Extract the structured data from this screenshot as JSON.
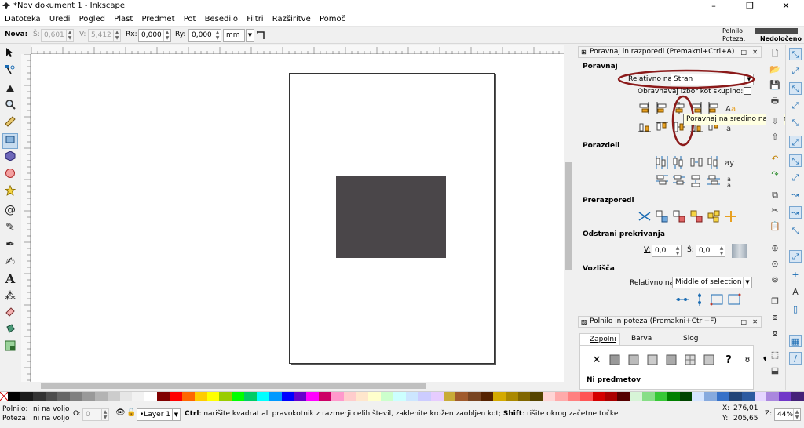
{
  "window": {
    "title": "*Nov dokument 1 - Inkscape",
    "min_glyph": "–",
    "max_glyph": "❐",
    "close_glyph": "✕"
  },
  "menu": [
    "Datoteka",
    "Uredi",
    "Pogled",
    "Plast",
    "Predmet",
    "Pot",
    "Besedilo",
    "Filtri",
    "Razširitve",
    "Pomoč"
  ],
  "tool_controls": {
    "label": "Nova:",
    "w_label": "Š:",
    "w_value": "0,601",
    "h_label": "V:",
    "h_value": "5,412",
    "rx_label": "Rx:",
    "rx_value": "0,000",
    "ry_label": "Ry:",
    "ry_value": "0,000",
    "unit": "mm"
  },
  "fill_indicator": {
    "fill_label": "Polnilo:",
    "stroke_label": "Poteza:",
    "stroke_value": "Nedoločeno",
    "fill_color": "#4a4a4a"
  },
  "tools": [
    "selector-icon",
    "node-icon",
    "tweak-icon",
    "zoom-icon",
    "measure-icon",
    "rect-icon",
    "3dbox-icon",
    "ellipse-icon",
    "star-icon",
    "spiral-icon",
    "pencil-icon",
    "pen-icon",
    "calligraphy-icon",
    "text-icon",
    "spray-icon",
    "eraser-icon",
    "bucket-icon",
    "gradient-icon"
  ],
  "canvas": {
    "rect_color": "#4a4649",
    "page_color": "#ffffff"
  },
  "align_dialog": {
    "title": "Poravnaj in razporedi  (Premakni+Ctrl+A)",
    "align_section": "Poravnaj",
    "relative_label": "Relativno na:",
    "relative_value": "Stran",
    "treat_group_label": "Obravnavaj izbor kot skupino:",
    "distribute_section": "Porazdeli",
    "rearrange_section": "Prerazporedi",
    "overlap_section": "Odstrani prekrivanja",
    "h_label": "V:",
    "h_value": "0,0",
    "v_label": "Š:",
    "v_value": "0,0",
    "nodes_section": "Vozlišča",
    "nodes_relative_label": "Relativno na:",
    "nodes_relative_value": "Middle of selection",
    "tooltip": "Poravnaj na sredino navpične osi"
  },
  "fill_dialog": {
    "title": "Polnilo in poteza  (Premakni+Ctrl+F)",
    "tabs": [
      "Zapolni",
      "Barva poteze",
      "Slog poteze"
    ],
    "no_object": "Ni predmetov"
  },
  "annotation_color": "#8b1a1a",
  "palette": [
    "#000000",
    "#1a1a1a",
    "#333333",
    "#4d4d4d",
    "#666666",
    "#808080",
    "#999999",
    "#b3b3b3",
    "#cccccc",
    "#e6e6e6",
    "#f2f2f2",
    "#ffffff",
    "#800000",
    "#ff0000",
    "#ff6600",
    "#ffcc00",
    "#ffff00",
    "#99cc00",
    "#00ff00",
    "#00cc66",
    "#00ffff",
    "#0099ff",
    "#0000ff",
    "#6600cc",
    "#ff00ff",
    "#cc0066",
    "#ff99cc",
    "#ffcccc",
    "#ffe6cc",
    "#ffffcc",
    "#ccffcc",
    "#ccffff",
    "#cce6ff",
    "#ccccff",
    "#e6ccff",
    "#c8ab37",
    "#a05a2c",
    "#784421",
    "#552200",
    "#d4aa00",
    "#aa8800",
    "#806600",
    "#554400",
    "#ffd5d5",
    "#ffaaaa",
    "#ff8080",
    "#ff5555",
    "#d40000",
    "#aa0000",
    "#550000",
    "#d7f4d7",
    "#87de87",
    "#37c837",
    "#008000",
    "#004400",
    "#d5e5ff",
    "#87aade",
    "#3771c8",
    "#214478",
    "#2c5aa0",
    "#e5d5ff",
    "#aa87de",
    "#7137c8",
    "#442178"
  ],
  "status": {
    "fill_label": "Polnilo:",
    "fill_value": "ni na voljo",
    "stroke_label": "Poteza:",
    "stroke_value": "ni na voljo",
    "opacity_label": "O:",
    "opacity_value": "0",
    "layer": "•Layer 1",
    "message_bold1": "Ctrl",
    "message1": ": narišite kvadrat ali pravokotnik z razmerji celih števil, zaklenite krožen zaobljen kot; ",
    "message_bold2": "Shift",
    "message2": ": rišite okrog začetne točke",
    "x_label": "X:",
    "x_value": "276,01",
    "y_label": "Y:",
    "y_value": "205,65",
    "zoom_label": "Z:",
    "zoom_value": "44%"
  }
}
